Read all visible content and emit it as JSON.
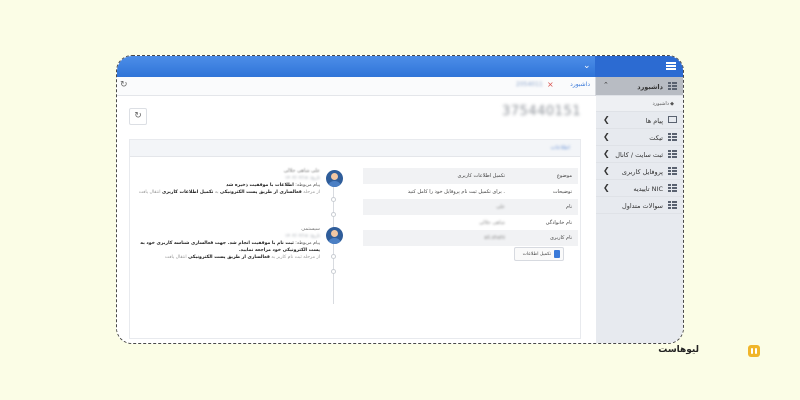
{
  "sidebar": {
    "items": [
      {
        "label": "داشبورد",
        "active": true,
        "icon": "grid-icon"
      },
      {
        "label": "پیام ها",
        "icon": "mail-icon"
      },
      {
        "label": "تیکت",
        "icon": "grid-icon"
      },
      {
        "label": "ثبت سایت / کانال",
        "icon": "grid-icon"
      },
      {
        "label": "پروفایل کاربری",
        "icon": "grid-icon"
      },
      {
        "label": "تاییدیه NIC",
        "icon": "grid-icon"
      },
      {
        "label": "سوالات متداول",
        "icon": "grid-icon"
      }
    ],
    "sub_item": "داشبورد"
  },
  "tabs": {
    "home": "داشبورد",
    "ticket_id": "2054011"
  },
  "main": {
    "ticket_number": "375440151",
    "panel_title": "اطلاعات",
    "info": {
      "subject_key": "موضوع",
      "subject_val": "تکمیل اطلاعات کاربری",
      "desc_key": "توضیحات",
      "desc_val": "برای تکمیل ثبت نام پروفایل خود را کامل کنید .",
      "name_key": "نام",
      "name_val": "علی",
      "family_key": "نام خانوادگی",
      "family_val": "شاهی جلالی",
      "user_key": "نام کاربری",
      "user_val": "ali.shahi"
    },
    "complete_button": "تکمیل اطلاعات",
    "timeline": [
      {
        "name": "علی شاهی جلالی",
        "date": "تاریخ: ۱۴۰۲/۰۲/۱۸",
        "line1a": "پیام مربوطه: ",
        "line1b": "اطلاعات با موفقیت ذخیره شد",
        "line2a": "از مرحله ",
        "line2b": "فعالسازی از طریق پست الکترونیکی",
        "line2c": " به ",
        "line2d": "تکمیل اطلاعات کاربری",
        "line2e": " انتقال یافت"
      },
      {
        "name": "سیستمی",
        "date": "تاریخ: ۱۴۰۲/۰۲/۱۸",
        "line1a": "پیام مربوطه: ",
        "line1b": "ثبت نام با موفقیت انجام شد. جهت فعالسازی شناسه کاربری خود به پست الکترونیکی خود مراجعه نمایید.",
        "line2a": "از مرحله ثبت نام کاربر به ",
        "line2b": "فعالسازی از طریق پست الکترونیکی",
        "line2c": " انتقال یافت"
      }
    ]
  },
  "brand": {
    "name": "لیوهاست"
  }
}
